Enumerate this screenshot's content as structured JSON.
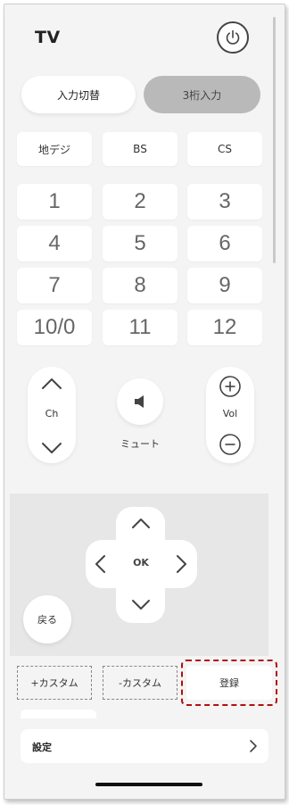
{
  "header": {
    "title": "TV",
    "power_icon": "power-icon"
  },
  "mode_buttons": {
    "input_switch": "入力切替",
    "three_digit": "3桁入力"
  },
  "broadcast": [
    "地デジ",
    "BS",
    "CS"
  ],
  "numpad": [
    "1",
    "2",
    "3",
    "4",
    "5",
    "6",
    "7",
    "8",
    "9",
    "10/0",
    "11",
    "12"
  ],
  "channel": {
    "label": "Ch"
  },
  "volume": {
    "label": "Vol"
  },
  "mute": {
    "label": "ミュート"
  },
  "dpad": {
    "ok_label": "OK"
  },
  "back": {
    "label": "戻る"
  },
  "custom": {
    "plus": "+カスタム",
    "minus": "-カスタム",
    "register": "登録"
  },
  "settings": {
    "label": "設定"
  },
  "colors": {
    "highlight_border": "#b01010",
    "selected_pill": "#b9b9b9",
    "background": "#f4f4f4"
  }
}
